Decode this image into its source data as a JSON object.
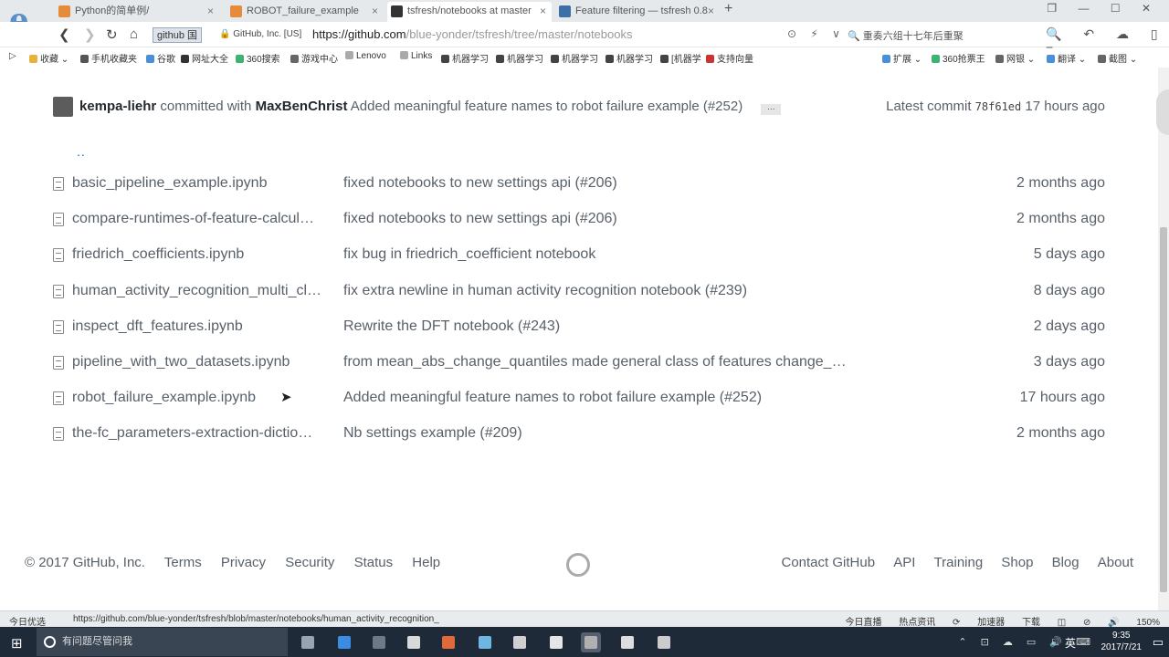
{
  "browser": {
    "logo": "e",
    "tabs": [
      {
        "label": "Python的简单例/",
        "color": "#e58b3a"
      },
      {
        "label": "ROBOT_failure_example",
        "color": "#e58b3a"
      },
      {
        "label": "tsfresh/notebooks at master",
        "color": "#333333"
      },
      {
        "label": "Feature filtering — tsfresh 0.8",
        "color": "#3c6ea8"
      }
    ],
    "new_tab": "+",
    "window_controls": "❐ — ☐ ✕",
    "site_chip": "github 国",
    "cert_label": "GitHub, Inc. [US]",
    "url_host": "https://github.com",
    "url_path": "/blue-yonder/tsfresh/tree/master/notebooks",
    "address_icons": "⊙ ⚡ ∨",
    "search_hint": "🔍 重奏六组十七年后重聚",
    "right_tools": "🔍 ↶ ☁ ▯ ≡"
  },
  "bookmarks": [
    {
      "label": "收藏 ⌄",
      "color": "#e8b33a"
    },
    {
      "label": "手机收藏夹",
      "color": "#555555"
    },
    {
      "label": "谷歌",
      "color": "#4a90d9"
    },
    {
      "label": "网址大全",
      "color": "#333333"
    },
    {
      "label": "360搜索",
      "color": "#3cb371"
    },
    {
      "label": "游戏中心",
      "color": "#666666"
    },
    {
      "label": "Lenovo",
      "color": "#aaaaaa"
    },
    {
      "label": "Links",
      "color": "#aaaaaa"
    },
    {
      "label": "机器学习",
      "color": "#444444"
    },
    {
      "label": "机器学习",
      "color": "#444444"
    },
    {
      "label": "机器学习",
      "color": "#444444"
    },
    {
      "label": "机器学习",
      "color": "#444444"
    },
    {
      "label": "[机器学",
      "color": "#444444"
    },
    {
      "label": "支持向量",
      "color": "#cc3333"
    },
    {
      "label": "扩展 ⌄",
      "color": "#4a90d9"
    },
    {
      "label": "360抢票王",
      "color": "#3cb371"
    },
    {
      "label": "网银 ⌄",
      "color": "#666666"
    },
    {
      "label": "翻译 ⌄",
      "color": "#4a90d9"
    },
    {
      "label": "截图 ⌄",
      "color": "#666666"
    }
  ],
  "commit": {
    "author": "kempa-liehr",
    "committed_with": "committed with",
    "coauthor": "MaxBenChrist",
    "message": "Added meaningful feature names to robot failure example (#252)",
    "ellipsis": "…",
    "latest_label": "Latest commit",
    "sha": "78f61ed",
    "age": "17 hours ago"
  },
  "parent_dir": "..",
  "files": [
    {
      "name": "basic_pipeline_example.ipynb",
      "message": "fixed notebooks to new settings api (#206)",
      "age": "2 months ago"
    },
    {
      "name": "compare-runtimes-of-feature-calcul…",
      "message": "fixed notebooks to new settings api (#206)",
      "age": "2 months ago"
    },
    {
      "name": "friedrich_coefficients.ipynb",
      "message": "fix bug in friedrich_coefficient notebook",
      "age": "5 days ago"
    },
    {
      "name": "human_activity_recognition_multi_cl…",
      "message": "fix extra newline in human activity recognition notebook (#239)",
      "age": "8 days ago"
    },
    {
      "name": "inspect_dft_features.ipynb",
      "message": "Rewrite the DFT notebook (#243)",
      "age": "2 days ago"
    },
    {
      "name": "pipeline_with_two_datasets.ipynb",
      "message": "from mean_abs_change_quantiles made general class of features change_…",
      "age": "3 days ago"
    },
    {
      "name": "robot_failure_example.ipynb",
      "message": "Added meaningful feature names to robot failure example (#252)",
      "age": "17 hours ago"
    },
    {
      "name": "the-fc_parameters-extraction-dictio…",
      "message": "Nb settings example (#209)",
      "age": "2 months ago"
    }
  ],
  "footer": {
    "copyright": "© 2017 GitHub, Inc.",
    "left_links": [
      "Terms",
      "Privacy",
      "Security",
      "Status",
      "Help"
    ],
    "right_links": [
      "Contact GitHub",
      "API",
      "Training",
      "Shop",
      "Blog",
      "About"
    ]
  },
  "statusbar": {
    "left": "今日优选",
    "url": "https://github.com/blue-yonder/tsfresh/blob/master/notebooks/human_activity_recognition_",
    "right": [
      "今日直播",
      "热点资讯",
      "⟳",
      "加速器",
      "下载",
      "◫",
      "⊘",
      "🔊",
      "150%"
    ]
  },
  "taskbar": {
    "search_placeholder": "有问题尽管问我",
    "apps": [
      "#9aa4b0",
      "#3a8de0",
      "#6b7a8a",
      "#d9d9d9",
      "#e06a3a",
      "#6fb6e0",
      "#d0d0d0",
      "#e5e5e5",
      "#b0b0b0",
      "#dddddd",
      "#cccccc"
    ],
    "tray": "⌃ ⊡ ☁ ▭ 🔊 ⌨",
    "ime": "英",
    "time": "9:35",
    "date": "2017/7/21"
  }
}
